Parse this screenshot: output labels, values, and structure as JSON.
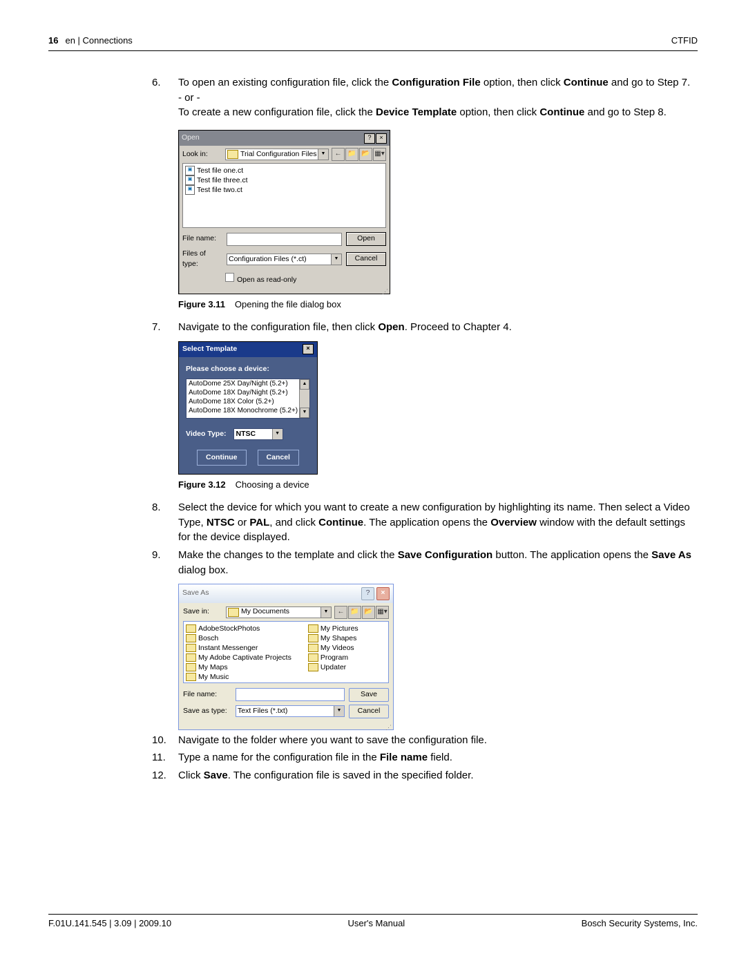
{
  "header": {
    "page_no": "16",
    "section": "en | Connections",
    "doc_id": "CTFID"
  },
  "footer": {
    "left": "F.01U.141.545 | 3.09 | 2009.10",
    "center": "User's Manual",
    "right": "Bosch Security Systems, Inc."
  },
  "steps": {
    "s6": {
      "num": "6.",
      "p1a": "To open an existing configuration file, click the ",
      "p1b": "Configuration File",
      "p1c": " option, then click ",
      "p1d": "Continue",
      "p1e": " and go to Step 7.",
      "or": "- or -",
      "p2a": "To create a new configuration file, click the ",
      "p2b": "Device Template",
      "p2c": " option, then click ",
      "p2d": "Continue",
      "p2e": " and go to Step 8."
    },
    "s7": {
      "num": "7.",
      "a": "Navigate to the configuration file, then click ",
      "b": "Open",
      "c": ". Proceed to Chapter 4."
    },
    "s8": {
      "num": "8.",
      "a": "Select the device for which you want to create a new configuration by highlighting its name. Then select a Video Type, ",
      "b": "NTSC",
      "c": " or ",
      "d": "PAL",
      "e": ", and click ",
      "f": "Continue",
      "g": ". The application opens the ",
      "h": "Overview",
      "i": " window with the default settings for the device displayed."
    },
    "s9": {
      "num": "9.",
      "a": "Make the changes to the template and click the ",
      "b": "Save Configuration",
      "c": " button. The application opens the ",
      "d": "Save As",
      "e": " dialog box."
    },
    "s10": {
      "num": "10.",
      "text": "Navigate to the folder where you want to save the configuration file."
    },
    "s11": {
      "num": "11.",
      "a": "Type a name for the configuration file in the ",
      "b": "File name",
      "c": " field."
    },
    "s12": {
      "num": "12.",
      "a": "Click ",
      "b": "Save",
      "c": ". The configuration file is saved in the specified folder."
    }
  },
  "fig311": {
    "label": "Figure 3.11",
    "caption": "Opening the file dialog box"
  },
  "fig312": {
    "label": "Figure 3.12",
    "caption": "Choosing a device"
  },
  "open_dlg": {
    "title": "Open",
    "lookin_label": "Look in:",
    "lookin_value": "Trial Configuration Files",
    "files": [
      "Test file one.ct",
      "Test file three.ct",
      "Test file two.ct"
    ],
    "filename_label": "File name:",
    "filetype_label": "Files of type:",
    "filetype_value": "Configuration Files (*.ct)",
    "readonly": "Open as read-only",
    "open_btn": "Open",
    "cancel_btn": "Cancel"
  },
  "tpl_dlg": {
    "title": "Select Template",
    "prompt": "Please choose a device:",
    "devices": [
      "AutoDome 25X Day/Night (5.2+)",
      "AutoDome 18X Day/Night (5.2+)",
      "AutoDome 18X Color (5.2+)",
      "AutoDome 18X Monochrome (5.2+)"
    ],
    "video_type_label": "Video Type:",
    "video_type_value": "NTSC",
    "continue": "Continue",
    "cancel": "Cancel"
  },
  "save_dlg": {
    "title": "Save As",
    "savein_label": "Save in:",
    "savein_value": "My Documents",
    "col1": [
      "AdobeStockPhotos",
      "Bosch",
      "Instant Messenger",
      "My Adobe Captivate Projects",
      "My Maps",
      "My Music"
    ],
    "col2": [
      "My Pictures",
      "My Shapes",
      "My Videos",
      "Program",
      "Updater"
    ],
    "filename_label": "File name:",
    "saveastype_label": "Save as type:",
    "saveastype_value": "Text Files (*.txt)",
    "save_btn": "Save",
    "cancel_btn": "Cancel"
  }
}
